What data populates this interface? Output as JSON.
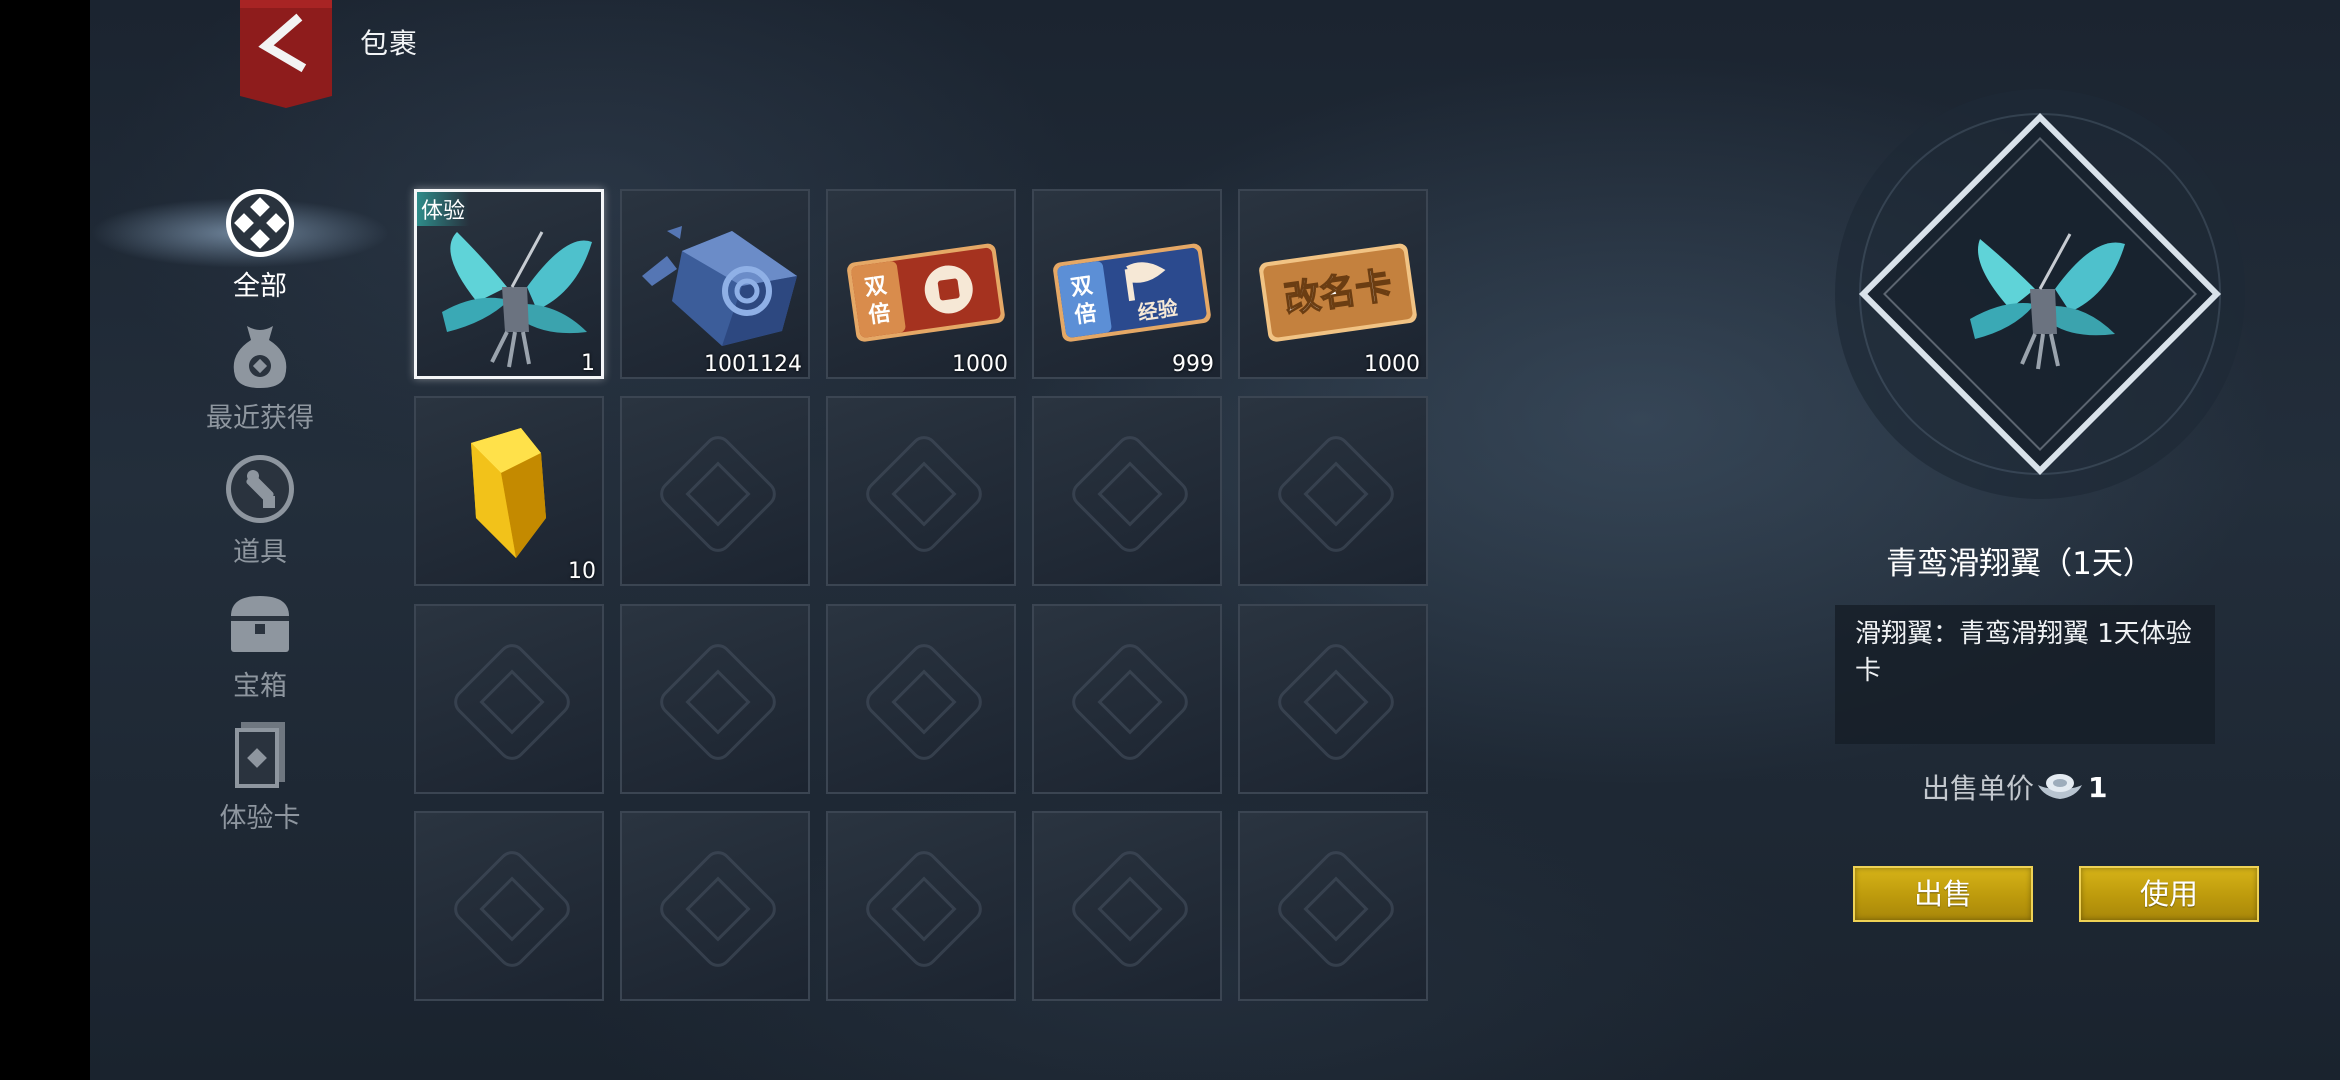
{
  "header": {
    "title": "包裹"
  },
  "sidebar": {
    "items": [
      {
        "label": "全部",
        "icon": "all-diamond-icon",
        "active": true
      },
      {
        "label": "最近获得",
        "icon": "money-bag-icon",
        "active": false
      },
      {
        "label": "道具",
        "icon": "tools-icon",
        "active": false
      },
      {
        "label": "宝箱",
        "icon": "treasure-chest-icon",
        "active": false
      },
      {
        "label": "体验卡",
        "icon": "trial-card-icon",
        "active": false
      }
    ]
  },
  "grid": {
    "items": [
      {
        "name": "青鸾滑翔翼",
        "icon": "glider-wings-icon",
        "count": "1",
        "tag": "体验",
        "selected": true
      },
      {
        "name": "蓝色矿石",
        "icon": "blue-ore-icon",
        "count": "1001124"
      },
      {
        "name": "双倍铜币卡",
        "icon": "double-coin-card-icon",
        "count": "1000",
        "card_text": [
          "双",
          "倍"
        ]
      },
      {
        "name": "双倍经验卡",
        "icon": "double-exp-card-icon",
        "count": "999",
        "card_text": [
          "双",
          "倍",
          "经验"
        ]
      },
      {
        "name": "改名卡",
        "icon": "rename-card-icon",
        "count": "1000",
        "card_text": [
          "改名卡"
        ]
      },
      {
        "name": "黄色宝石",
        "icon": "yellow-gem-icon",
        "count": "10"
      }
    ],
    "empty_slots": 14
  },
  "detail": {
    "name": "青鸾滑翔翼（1天）",
    "description": "滑翔翼：青鸾滑翔翼 1天体验卡",
    "price_label": "出售单价",
    "price_value": "1",
    "price_icon": "silver-ingot-icon",
    "sell_label": "出售",
    "use_label": "使用"
  },
  "colors": {
    "button_gold": "#c9a612",
    "selected_border": "#f4f6f8",
    "tag_teal": "#2e8c8a"
  }
}
